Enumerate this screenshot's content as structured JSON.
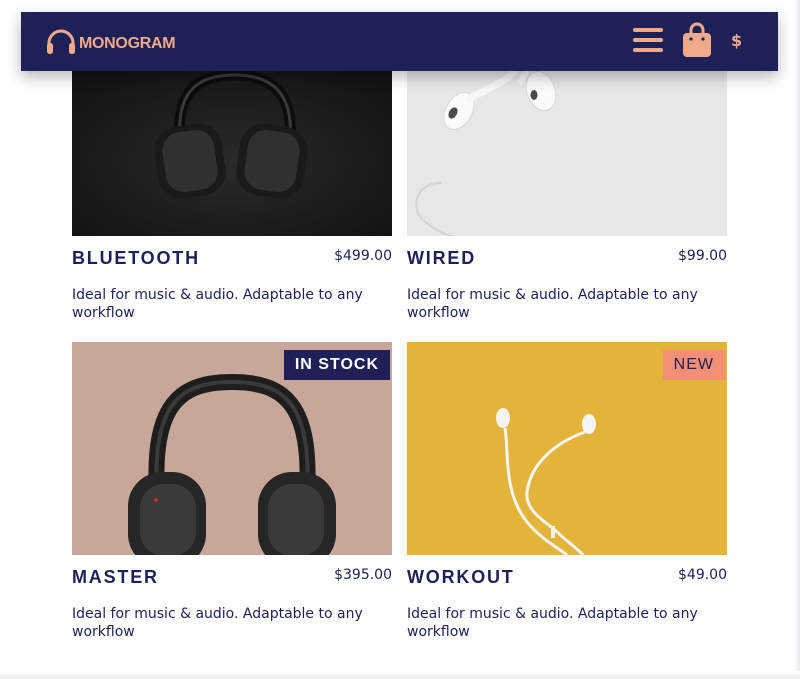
{
  "header": {
    "brand": "MONOGRAM",
    "currency_symbol": "$",
    "icons": [
      "headphones-icon",
      "menu-icon",
      "shopping-bag-icon"
    ],
    "colors": {
      "background": "#1d2157",
      "accent": "#f0a989"
    }
  },
  "products": [
    {
      "title": "BLUETOOTH",
      "price": "$499.00",
      "description": "Ideal for music & audio. Adaptable to any workflow",
      "badge": ""
    },
    {
      "title": "WIRED",
      "price": "$99.00",
      "description": "Ideal for music & audio. Adaptable to any workflow",
      "badge": ""
    },
    {
      "title": "MASTER",
      "price": "$395.00",
      "description": "Ideal for music & audio. Adaptable to any workflow",
      "badge": "IN STOCK"
    },
    {
      "title": "WORKOUT",
      "price": "$49.00",
      "description": "Ideal for music & audio. Adaptable to any workflow",
      "badge": "NEW"
    }
  ],
  "colors": {
    "text": "#1d2157",
    "badge_new": "#f48e76",
    "badge_in_stock": "#1d2157"
  }
}
